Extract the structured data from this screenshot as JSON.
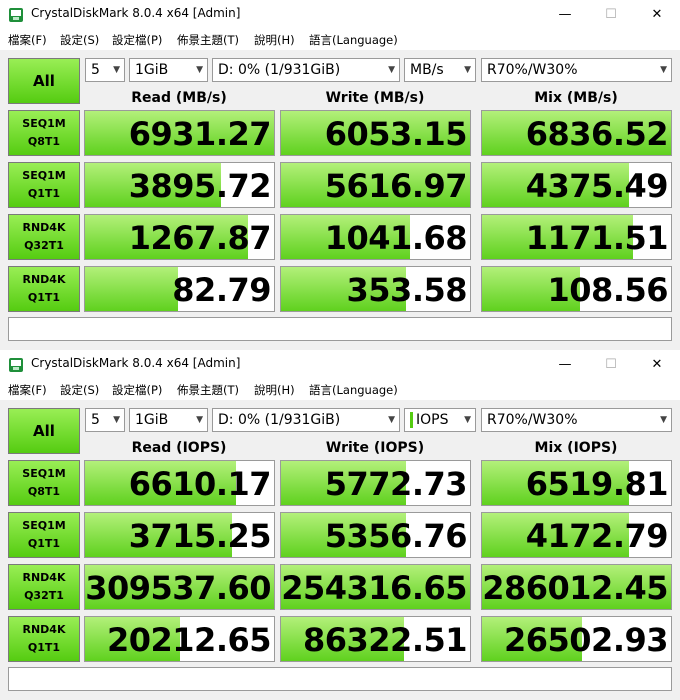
{
  "windows": [
    {
      "title": "CrystalDiskMark 8.0.4 x64 [Admin]",
      "menu": [
        "檔案(F)",
        "設定(S)",
        "設定檔(P)",
        "佈景主題(T)",
        "說明(H)",
        "語言(Language)"
      ],
      "controls": {
        "all_label": "All",
        "count": "5",
        "size": "1GiB",
        "drive": "D: 0% (1/931GiB)",
        "unit": "MB/s",
        "mix": "R70%/W30%"
      },
      "columns": [
        "Read (MB/s)",
        "Write (MB/s)",
        "Mix (MB/s)"
      ],
      "rows": [
        {
          "label1": "SEQ1M",
          "label2": "Q8T1",
          "values": [
            "6931.27",
            "6053.15",
            "6836.52"
          ],
          "fill": [
            1.0,
            1.0,
            1.0
          ]
        },
        {
          "label1": "SEQ1M",
          "label2": "Q1T1",
          "values": [
            "3895.72",
            "5616.97",
            "4375.49"
          ],
          "fill": [
            0.72,
            1.0,
            0.78
          ]
        },
        {
          "label1": "RND4K",
          "label2": "Q32T1",
          "values": [
            "1267.87",
            "1041.68",
            "1171.51"
          ],
          "fill": [
            0.86,
            0.68,
            0.8
          ]
        },
        {
          "label1": "RND4K",
          "label2": "Q1T1",
          "values": [
            "82.79",
            "353.58",
            "108.56"
          ],
          "fill": [
            0.49,
            0.66,
            0.52
          ]
        }
      ]
    },
    {
      "title": "CrystalDiskMark 8.0.4 x64 [Admin]",
      "menu": [
        "檔案(F)",
        "設定(S)",
        "設定檔(P)",
        "佈景主題(T)",
        "說明(H)",
        "語言(Language)"
      ],
      "controls": {
        "all_label": "All",
        "count": "5",
        "size": "1GiB",
        "drive": "D: 0% (1/931GiB)",
        "unit": "IOPS",
        "mix": "R70%/W30%"
      },
      "columns": [
        "Read (IOPS)",
        "Write (IOPS)",
        "Mix (IOPS)"
      ],
      "rows": [
        {
          "label1": "SEQ1M",
          "label2": "Q8T1",
          "values": [
            "6610.17",
            "5772.73",
            "6519.81"
          ],
          "fill": [
            0.8,
            0.66,
            0.78
          ]
        },
        {
          "label1": "SEQ1M",
          "label2": "Q1T1",
          "values": [
            "3715.25",
            "5356.76",
            "4172.79"
          ],
          "fill": [
            0.78,
            0.66,
            0.78
          ]
        },
        {
          "label1": "RND4K",
          "label2": "Q32T1",
          "values": [
            "309537.60",
            "254316.65",
            "286012.45"
          ],
          "fill": [
            1.0,
            1.0,
            1.0
          ]
        },
        {
          "label1": "RND4K",
          "label2": "Q1T1",
          "values": [
            "20212.65",
            "86322.51",
            "26502.93"
          ],
          "fill": [
            0.5,
            0.65,
            0.53
          ]
        }
      ]
    }
  ]
}
